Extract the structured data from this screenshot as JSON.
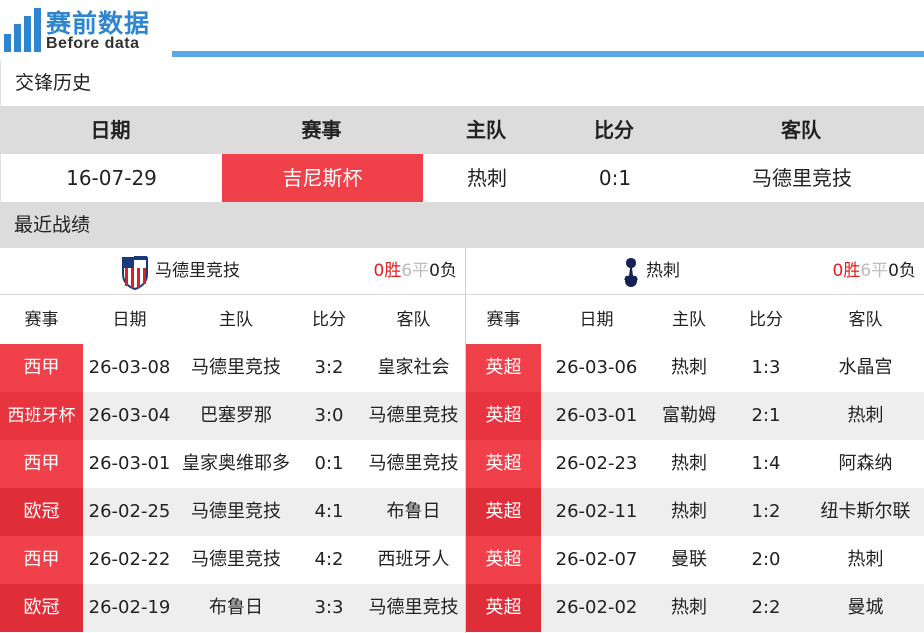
{
  "header": {
    "title": "赛前数据",
    "subtitle": "Before data",
    "accent_color": "#2f86d0"
  },
  "h2h": {
    "section_title": "交锋历史",
    "columns": [
      "日期",
      "赛事",
      "主队",
      "比分",
      "客队"
    ],
    "rows": [
      {
        "date": "16-07-29",
        "competition": "吉尼斯杯",
        "home": "热刺",
        "score": "0:1",
        "away": "马德里竞技"
      }
    ],
    "highlight_color": "#f0404a"
  },
  "recent": {
    "section_title": "最近战绩",
    "columns": [
      "赛事",
      "日期",
      "主队",
      "比分",
      "客队"
    ],
    "left": {
      "team": "马德里竞技",
      "crest_icon": "atletico-madrid-crest-icon",
      "record": {
        "wins": "0",
        "win_label": "胜",
        "draws": "6",
        "draw_label": "平",
        "losses": "0",
        "loss_label": "负"
      },
      "matches": [
        {
          "competition": "西甲",
          "date": "26-03-08",
          "home": "马德里竞技",
          "score": "3:2",
          "away": "皇家社会",
          "comp_color": "#f0404a"
        },
        {
          "competition": "西班牙杯",
          "date": "26-03-04",
          "home": "巴塞罗那",
          "score": "3:0",
          "away": "马德里竞技",
          "comp_color": "#e8343e"
        },
        {
          "competition": "西甲",
          "date": "26-03-01",
          "home": "皇家奥维耶多",
          "score": "0:1",
          "away": "马德里竞技",
          "comp_color": "#f0404a"
        },
        {
          "competition": "欧冠",
          "date": "26-02-25",
          "home": "马德里竞技",
          "score": "4:1",
          "away": "布鲁日",
          "comp_color": "#e02e38"
        },
        {
          "competition": "西甲",
          "date": "26-02-22",
          "home": "马德里竞技",
          "score": "4:2",
          "away": "西班牙人",
          "comp_color": "#f0404a"
        },
        {
          "competition": "欧冠",
          "date": "26-02-19",
          "home": "布鲁日",
          "score": "3:3",
          "away": "马德里竞技",
          "comp_color": "#e02e38"
        }
      ]
    },
    "right": {
      "team": "热刺",
      "crest_icon": "tottenham-crest-icon",
      "record": {
        "wins": "0",
        "win_label": "胜",
        "draws": "6",
        "draw_label": "平",
        "losses": "0",
        "loss_label": "负"
      },
      "matches": [
        {
          "competition": "英超",
          "date": "26-03-06",
          "home": "热刺",
          "score": "1:3",
          "away": "水晶宫",
          "comp_color": "#f0404a"
        },
        {
          "competition": "英超",
          "date": "26-03-01",
          "home": "富勒姆",
          "score": "2:1",
          "away": "热刺",
          "comp_color": "#e8343e"
        },
        {
          "competition": "英超",
          "date": "26-02-23",
          "home": "热刺",
          "score": "1:4",
          "away": "阿森纳",
          "comp_color": "#f0404a"
        },
        {
          "competition": "英超",
          "date": "26-02-11",
          "home": "热刺",
          "score": "1:2",
          "away": "纽卡斯尔联",
          "comp_color": "#e02e38"
        },
        {
          "competition": "英超",
          "date": "26-02-07",
          "home": "曼联",
          "score": "2:0",
          "away": "热刺",
          "comp_color": "#f0404a"
        },
        {
          "competition": "英超",
          "date": "26-02-02",
          "home": "热刺",
          "score": "2:2",
          "away": "曼城",
          "comp_color": "#e02e38"
        }
      ]
    }
  }
}
